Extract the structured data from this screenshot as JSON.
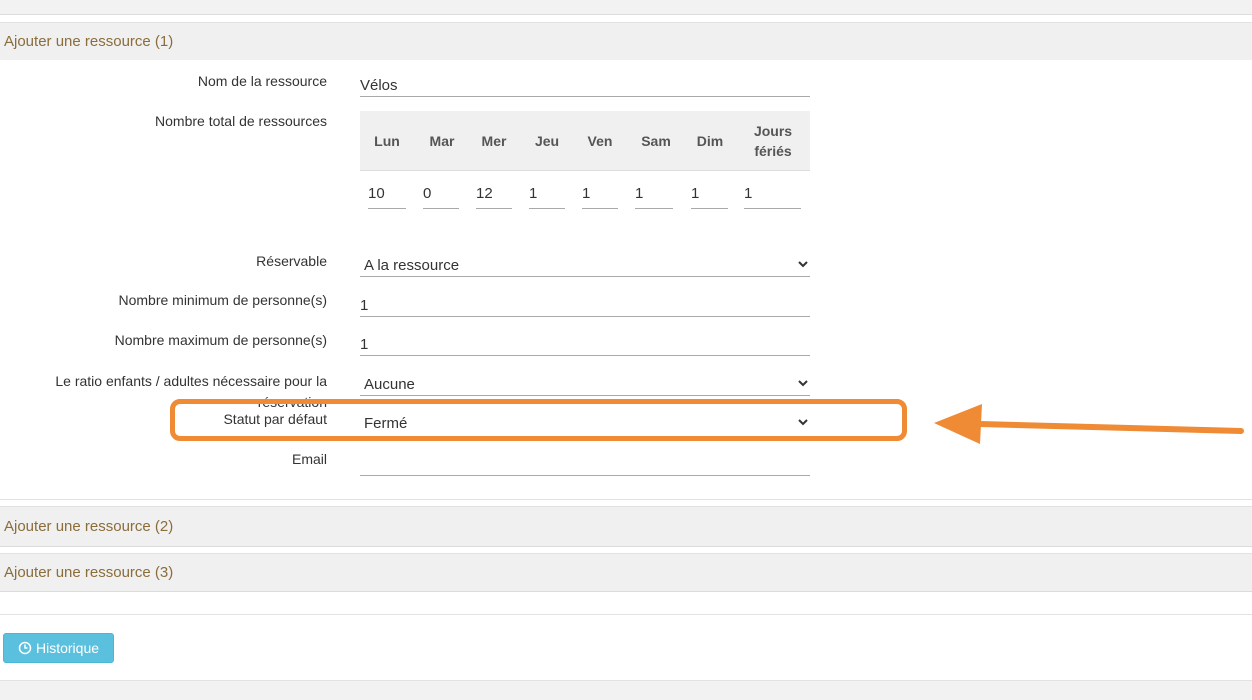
{
  "sections": {
    "first": "Ajouter une ressource (1)",
    "second": "Ajouter une ressource (2)",
    "third": "Ajouter une ressource (3)"
  },
  "form": {
    "name_label": "Nom de la ressource",
    "name_value": "Vélos",
    "total_label": "Nombre total de ressources",
    "days": [
      {
        "header": "Lun",
        "value": "10"
      },
      {
        "header": "Mar",
        "value": "0"
      },
      {
        "header": "Mer",
        "value": "12"
      },
      {
        "header": "Jeu",
        "value": "1"
      },
      {
        "header": "Ven",
        "value": "1"
      },
      {
        "header": "Sam",
        "value": "1"
      },
      {
        "header": "Dim",
        "value": "1"
      },
      {
        "header": "Jours fériés",
        "value": "1"
      }
    ],
    "bookable_label": "Réservable",
    "bookable_value": "A la ressource",
    "min_label": "Nombre minimum de personne(s)",
    "min_value": "1",
    "max_label": "Nombre maximum de personne(s)",
    "max_value": "1",
    "ratio_label": "Le ratio enfants / adultes nécessaire pour la réservation",
    "ratio_value": "Aucune",
    "status_label": "Statut par défaut",
    "status_value": "Fermé",
    "email_label": "Email",
    "email_value": ""
  },
  "history_button": "Historique",
  "colors": {
    "annotation": "#ef8a35",
    "section_text": "#8a6d3b",
    "button": "#5bc0de"
  },
  "icons": {
    "dropdown": "chevron-down-icon",
    "history": "clock-icon",
    "annotation": "arrow-left-icon"
  }
}
